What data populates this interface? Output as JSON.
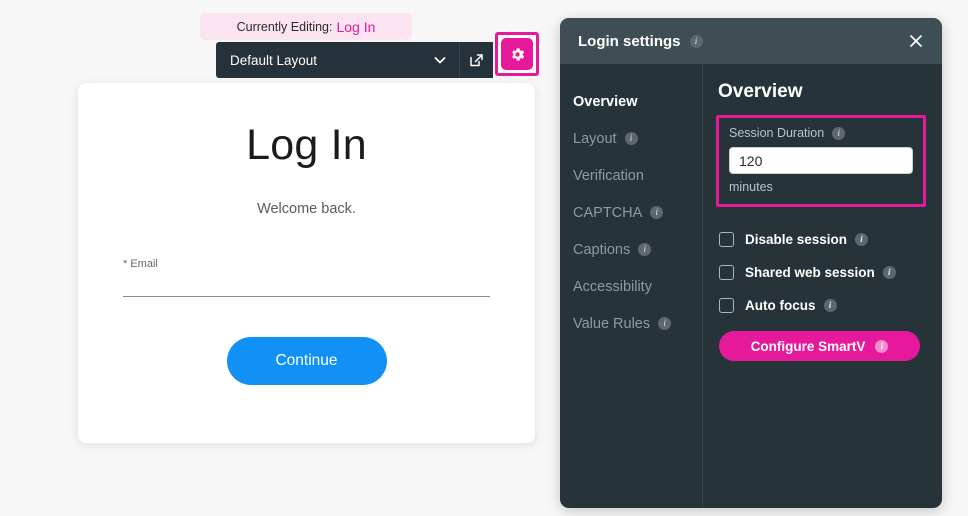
{
  "editor": {
    "editing_prefix": "Currently Editing:",
    "editing_target": "Log In",
    "layout_select_value": "Default Layout",
    "open_external_icon": "external-link-icon",
    "settings_icon": "gear-icon",
    "chevron_icon": "chevron-down-icon"
  },
  "login_preview": {
    "title": "Log In",
    "subtitle": "Welcome back.",
    "email_required_mark": "*",
    "email_label": "Email",
    "email_value": "",
    "email_placeholder": "",
    "continue_label": "Continue"
  },
  "panel": {
    "title": "Login settings",
    "close_icon": "close-icon",
    "info_icon": "info-icon",
    "sidebar": {
      "items": [
        {
          "label": "Overview",
          "active": true,
          "info": false
        },
        {
          "label": "Layout",
          "active": false,
          "info": true
        },
        {
          "label": "Verification",
          "active": false,
          "info": false
        },
        {
          "label": "CAPTCHA",
          "active": false,
          "info": true
        },
        {
          "label": "Captions",
          "active": false,
          "info": true
        },
        {
          "label": "Accessibility",
          "active": false,
          "info": false
        },
        {
          "label": "Value Rules",
          "active": false,
          "info": true
        }
      ]
    },
    "main": {
      "heading": "Overview",
      "session_duration": {
        "label": "Session Duration",
        "value": "120",
        "placeholder": "",
        "unit": "minutes"
      },
      "checkboxes": [
        {
          "label": "Disable session",
          "checked": false,
          "info": true
        },
        {
          "label": "Shared web session",
          "checked": false,
          "info": true
        },
        {
          "label": "Auto focus",
          "checked": false,
          "info": true
        }
      ],
      "smartv_button": "Configure SmartV"
    }
  },
  "colors": {
    "accent_magenta": "#e6189c",
    "panel_body": "#26343a",
    "panel_header": "#3f4d54",
    "toolbar_dark": "#26323b",
    "continue_blue": "#1190f5",
    "badge_pink": "#fbe3f1",
    "page_bg": "#f7f7f7"
  }
}
